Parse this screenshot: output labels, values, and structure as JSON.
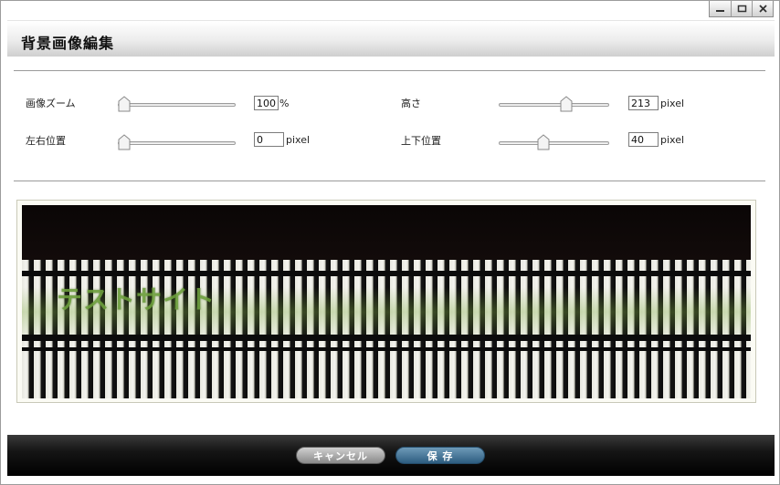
{
  "window": {
    "title": "背景画像編集",
    "controls": [
      "minimize-icon",
      "maximize-icon",
      "close-icon"
    ]
  },
  "controls": {
    "zoom": {
      "label": "画像ズーム",
      "value": "100",
      "unit": "%",
      "slider_fraction": 0.0
    },
    "height": {
      "label": "高さ",
      "value": "213",
      "unit": "pixel",
      "slider_fraction": 0.63
    },
    "horizontal": {
      "label": "左右位置",
      "value": "0",
      "unit": "pixel",
      "slider_fraction": 0.0
    },
    "vertical": {
      "label": "上下位置",
      "value": "40",
      "unit": "pixel",
      "slider_fraction": 0.39
    }
  },
  "preview": {
    "site_title": "テストサイト"
  },
  "footer": {
    "cancel_label": "キャンセル",
    "save_label": "保 存"
  },
  "colors": {
    "save_button": "#2d5d80",
    "cancel_button": "#8a8a8a",
    "site_title": "#6c9e3c"
  }
}
